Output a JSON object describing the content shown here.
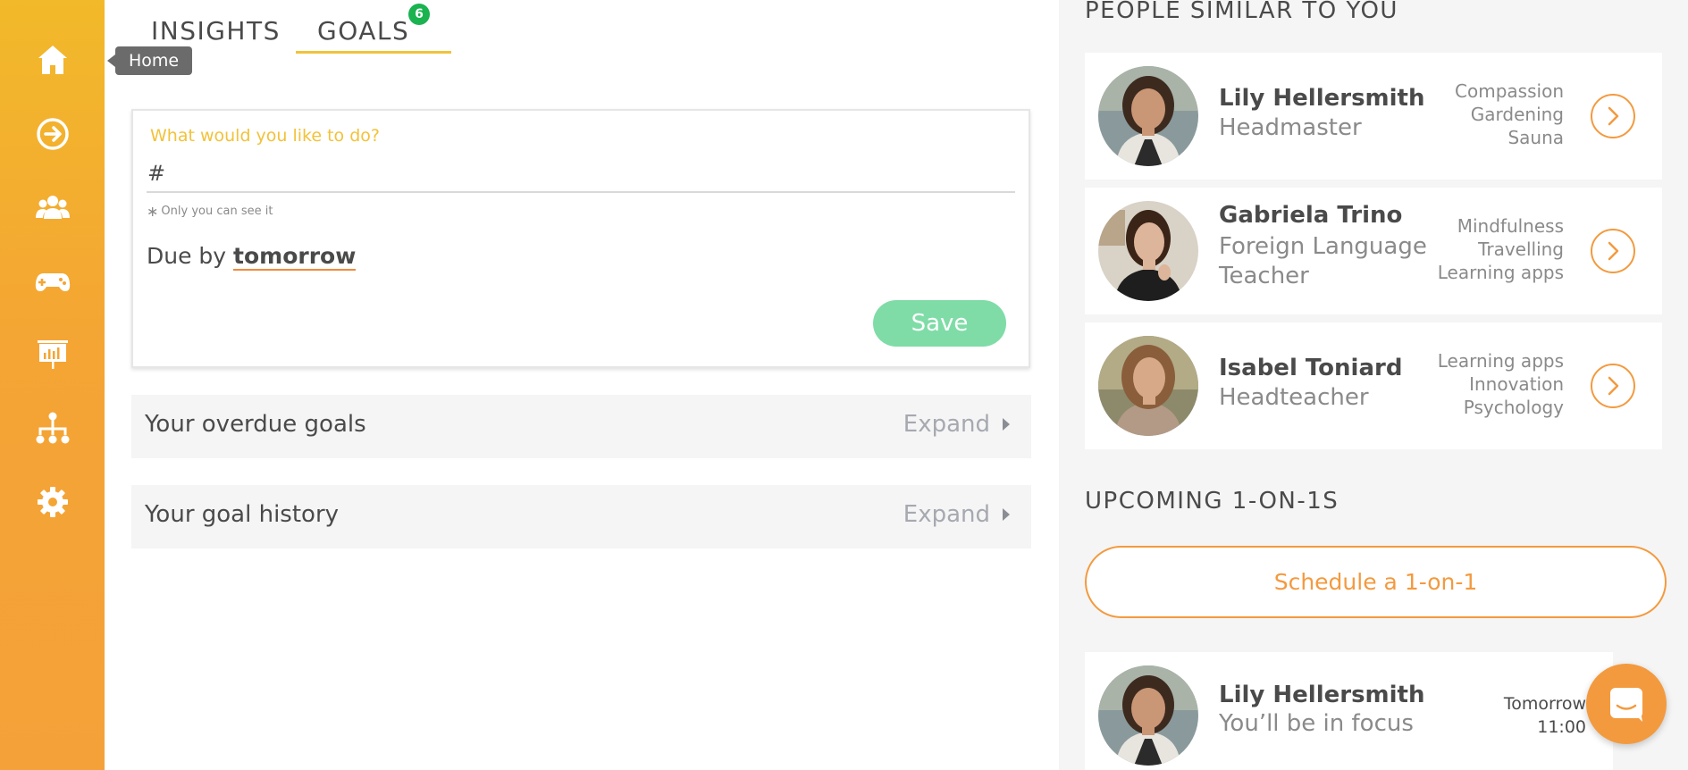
{
  "sidebar": {
    "items": [
      {
        "icon": "home-icon"
      },
      {
        "icon": "arrow-circle-icon"
      },
      {
        "icon": "people-icon"
      },
      {
        "icon": "gamepad-icon"
      },
      {
        "icon": "presentation-icon"
      },
      {
        "icon": "org-chart-icon"
      },
      {
        "icon": "gear-icon"
      }
    ],
    "tooltip": "Home"
  },
  "tabs": {
    "insights": "INSIGHTS",
    "goals": "GOALS",
    "goals_badge": "6"
  },
  "goal_form": {
    "label": "What would you like to do?",
    "input_value": "#",
    "note": "Only you can see it",
    "due_prefix": "Due by",
    "due_value": "tomorrow",
    "save_label": "Save"
  },
  "panels": [
    {
      "title": "Your overdue goals",
      "expand": "Expand"
    },
    {
      "title": "Your goal history",
      "expand": "Expand"
    }
  ],
  "similar": {
    "title": "PEOPLE SIMILAR TO YOU",
    "people": [
      {
        "name": "Lily Hellersmith",
        "role": "Headmaster",
        "tags": [
          "Compassion",
          "Gardening",
          "Sauna"
        ]
      },
      {
        "name": "Gabriela Trino",
        "role": "Foreign Language Teacher",
        "tags": [
          "Mindfulness",
          "Travelling",
          "Learning apps"
        ]
      },
      {
        "name": "Isabel Toniard",
        "role": "Headteacher",
        "tags": [
          "Learning apps",
          "Innovation",
          "Psychology"
        ]
      }
    ]
  },
  "upcoming": {
    "title": "UPCOMING 1-ON-1S",
    "schedule_label": "Schedule a 1-on-1",
    "meeting": {
      "name": "Lily Hellersmith",
      "subtitle": "You’ll be in focus",
      "day": "Tomorrow",
      "time": "11:00"
    }
  },
  "colors": {
    "accent": "#f39a3f",
    "highlight": "#f2c23a",
    "success": "#7fdca7",
    "badge": "#1ab350"
  }
}
